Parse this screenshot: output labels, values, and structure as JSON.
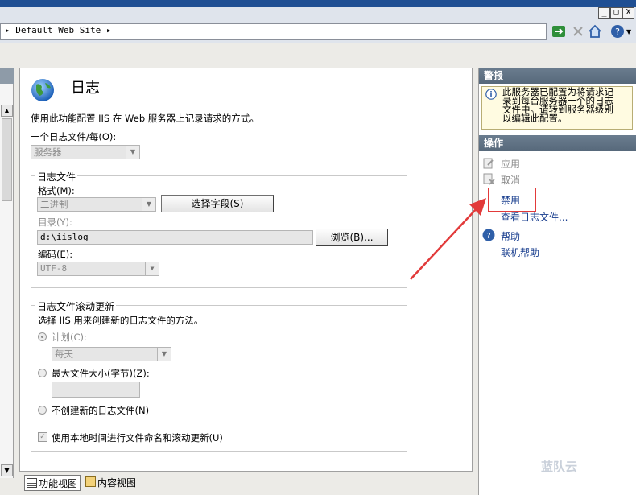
{
  "window": {
    "buttons": [
      "_",
      "□",
      "X"
    ]
  },
  "address": {
    "path": "▸ Default Web Site ▸"
  },
  "header": {
    "title": "日志",
    "description": "使用此功能配置 IIS 在 Web 服务器上记录请求的方式。"
  },
  "onefile": {
    "label": "一个日志文件/每(O):",
    "value": "服务器"
  },
  "logfile": {
    "group": "日志文件",
    "format_label": "格式(M):",
    "format_value": "二进制",
    "select_fields": "选择字段(S)",
    "dir_label": "目录(Y):",
    "dir_value": "d:\\iislog",
    "browse": "浏览(B)...",
    "encoding_label": "编码(E):",
    "encoding_value": "UTF-8"
  },
  "rollover": {
    "group": "日志文件滚动更新",
    "description": "选择 IIS 用来创建新的日志文件的方法。",
    "schedule_label": "计划(C):",
    "schedule_value": "每天",
    "maxsize_label": "最大文件大小(字节)(Z):",
    "maxsize_value": "",
    "nonew_label": "不创建新的日志文件(N)",
    "localtime_label": "使用本地时间进行文件命名和滚动更新(U)"
  },
  "alerts": {
    "title": "警报",
    "message_lines": [
      "此服务器已配置为将请求记",
      "录到每台服务器一个的日志",
      "文件中。请转到服务器级别",
      "以编辑此配置。"
    ]
  },
  "actions": {
    "title": "操作",
    "apply": "应用",
    "cancel": "取消",
    "disable": "禁用",
    "view_logs": "查看日志文件...",
    "help": "帮助",
    "online_help": "联机帮助"
  },
  "tabs": {
    "features": "功能视图",
    "content": "内容视图"
  },
  "watermark": "蓝队云",
  "colors": {
    "title_blue": "#1f4f93",
    "pane_header": "#5e7082",
    "link": "#1a3f8f",
    "annotation_red": "#e23a3a"
  }
}
